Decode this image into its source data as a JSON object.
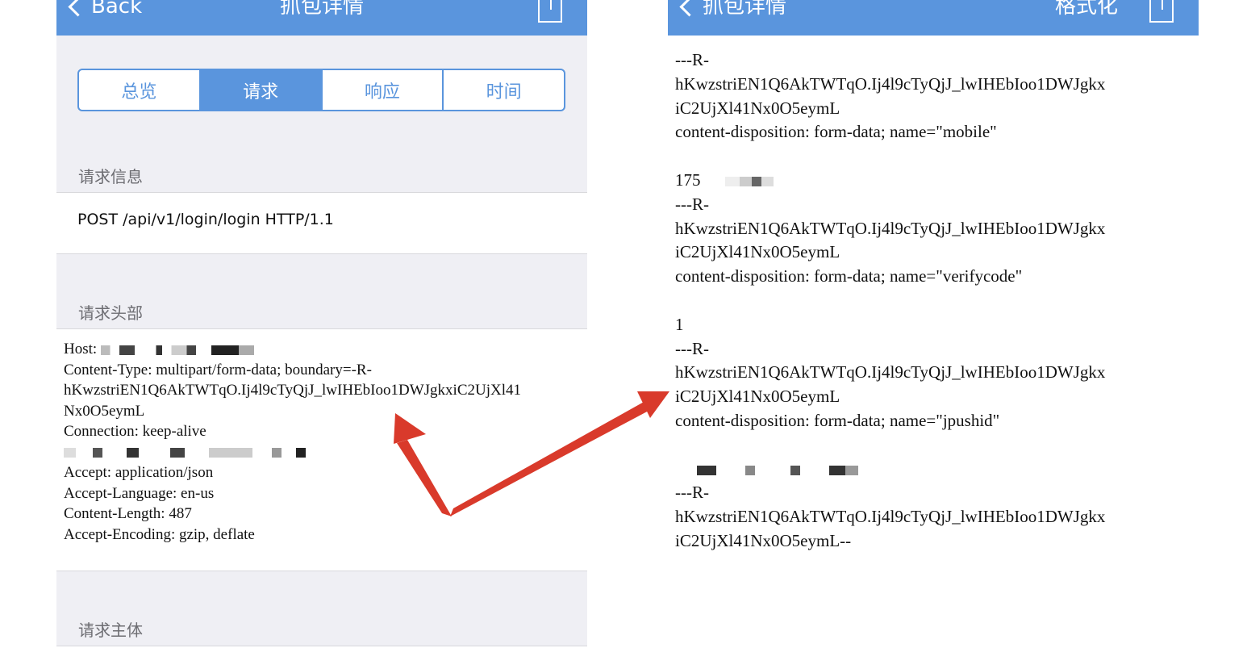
{
  "left": {
    "back_label": "Back",
    "title": "抓包详情",
    "tabs": [
      {
        "label": "总览",
        "active": false
      },
      {
        "label": "请求",
        "active": true
      },
      {
        "label": "响应",
        "active": false
      },
      {
        "label": "时间",
        "active": false
      }
    ],
    "sections": {
      "request_info": "请求信息",
      "request_headers": "请求头部",
      "request_body": "请求主体"
    },
    "request_line": "POST /api/v1/login/login HTTP/1.1",
    "headers": {
      "host_label": "Host:",
      "content_type": "Content-Type: multipart/form-data; boundary=-R-",
      "boundary_cont": "hKwzstriEN1Q6AkTWTqO.Ij4l9cTyQjJ_lwIHEbIoo1DWJgkxiC2UjXl41",
      "boundary_end": "Nx0O5eymL",
      "connection": "Connection: keep-alive",
      "accept": "Accept: application/json",
      "accept_language": "Accept-Language: en-us",
      "content_length": "Content-Length: 487",
      "accept_encoding": "Accept-Encoding: gzip, deflate"
    }
  },
  "right": {
    "title": "抓包详情",
    "format_label": "格式化",
    "body_lines": [
      "---R-",
      "hKwzstriEN1Q6AkTWTqO.Ij4l9cTyQjJ_lwIHEbIoo1DWJgkx",
      "iC2UjXl41Nx0O5eymL",
      "content-disposition: form-data; name=\"mobile\"",
      "",
      "175",
      "---R-",
      "hKwzstriEN1Q6AkTWTqO.Ij4l9cTyQjJ_lwIHEbIoo1DWJgkx",
      "iC2UjXl41Nx0O5eymL",
      "content-disposition: form-data; name=\"verifycode\"",
      "",
      "1",
      "---R-",
      "hKwzstriEN1Q6AkTWTqO.Ij4l9cTyQjJ_lwIHEbIoo1DWJgkx",
      "iC2UjXl41Nx0O5eymL",
      "content-disposition: form-data; name=\"jpushid\"",
      "",
      "",
      "---R-",
      "hKwzstriEN1Q6AkTWTqO.Ij4l9cTyQjJ_lwIHEbIoo1DWJgkx",
      "iC2UjXl41Nx0O5eymL--"
    ]
  },
  "colors": {
    "nav_blue": "#5a95dd",
    "arrow_red": "#d93a2b",
    "background_gray": "#efeff4"
  }
}
